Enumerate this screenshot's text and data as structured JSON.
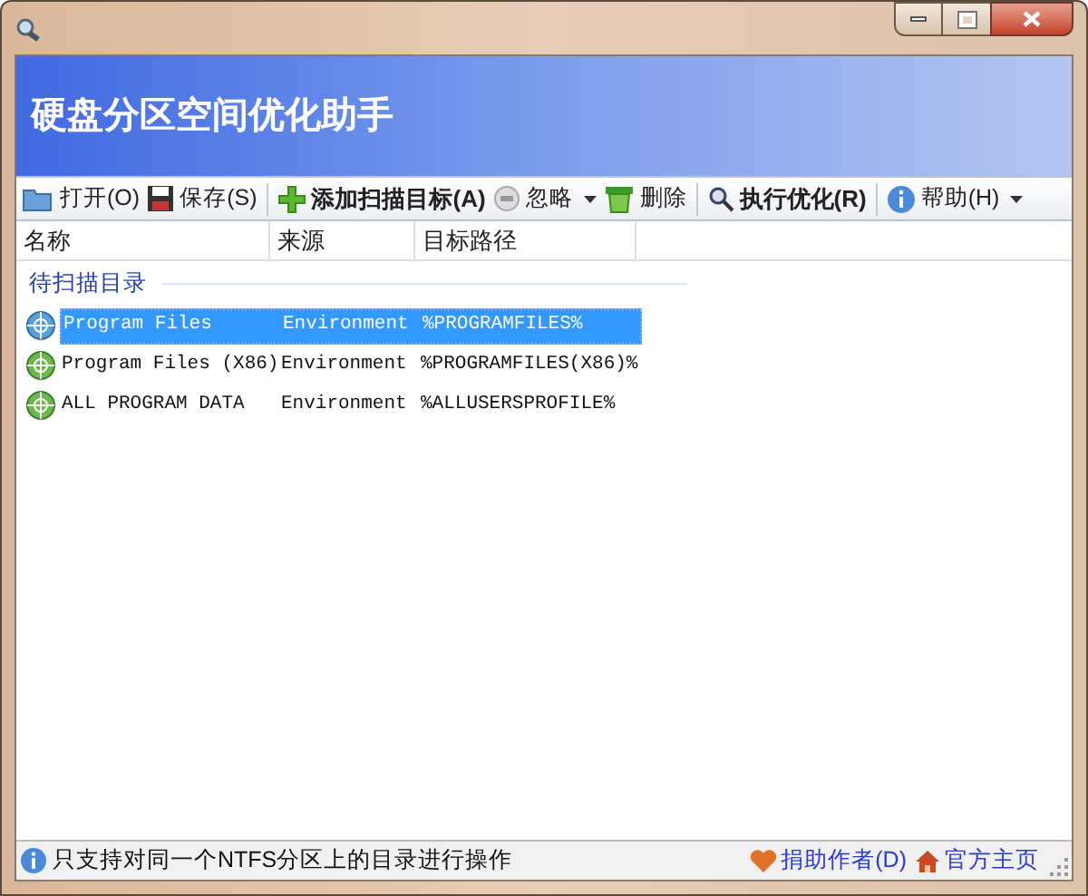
{
  "window": {
    "title": "硬盘分区空间优化助手"
  },
  "toolbar": [
    {
      "kind": "button",
      "label": "打开(O)",
      "bold": false,
      "dropdown": false
    },
    {
      "kind": "button",
      "label": "保存(S)",
      "bold": false,
      "dropdown": false
    },
    {
      "kind": "separator"
    },
    {
      "kind": "button",
      "label": "添加扫描目标(A)",
      "bold": true,
      "dropdown": false
    },
    {
      "kind": "button",
      "label": "忽略",
      "bold": false,
      "dropdown": true
    },
    {
      "kind": "button",
      "label": "删除",
      "bold": false,
      "dropdown": false
    },
    {
      "kind": "separator"
    },
    {
      "kind": "button",
      "label": "执行优化(R)",
      "bold": true,
      "dropdown": false
    },
    {
      "kind": "separator"
    },
    {
      "kind": "button",
      "label": "帮助(H)",
      "bold": false,
      "dropdown": true
    }
  ],
  "table": {
    "columns": [
      "名称",
      "来源",
      "目标路径"
    ],
    "group": "待扫描目录",
    "rows": [
      {
        "cells": [
          "Program Files",
          "Environment",
          "%PROGRAMFILES%"
        ],
        "selected": true
      },
      {
        "cells": [
          "Program Files (X86)",
          "Environment",
          "%PROGRAMFILES(X86)%"
        ],
        "selected": false
      },
      {
        "cells": [
          "ALL PROGRAM DATA",
          "Environment",
          "%ALLUSERSPROFILE%"
        ],
        "selected": false
      }
    ]
  },
  "status_bar": {
    "message": "只支持对同一个NTFS分区上的目录进行操作",
    "links": [
      "捐助作者(D)",
      "官方主页"
    ]
  }
}
